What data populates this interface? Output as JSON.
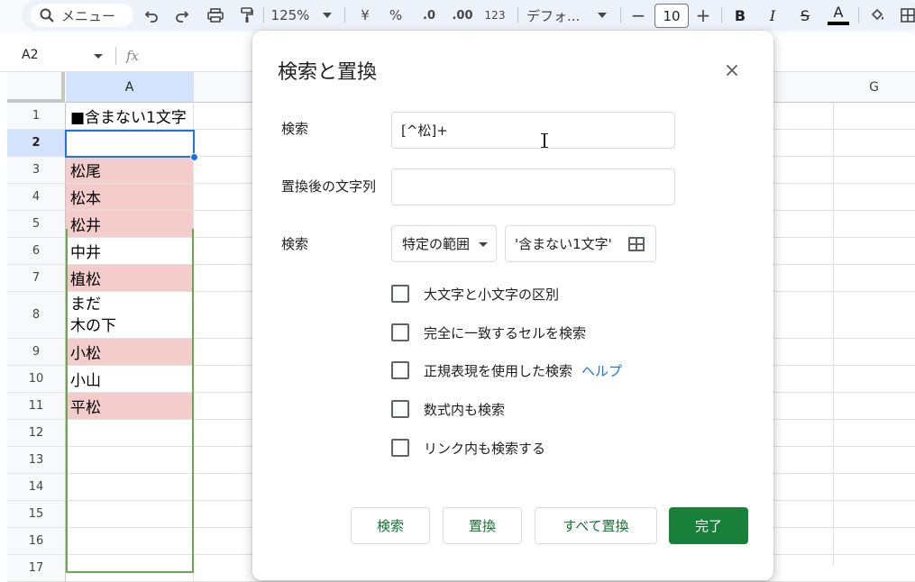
{
  "toolbar": {
    "menu_search_label": "メニュー",
    "zoom": "125%",
    "currency": "¥",
    "percent": "%",
    "decimal_decrease": ".0",
    "decimal_increase": ".00",
    "number_format": "123",
    "font": "デフォ...",
    "font_size": "10",
    "bold": "B",
    "italic": "I",
    "strike": "S",
    "text_color": "A"
  },
  "formula_bar": {
    "name_box": "A2",
    "fx": "fx"
  },
  "grid": {
    "col_headers": [
      "A",
      "G"
    ],
    "rows": [
      {
        "num": "1",
        "value": "■含まない1文字",
        "highlight": false
      },
      {
        "num": "2",
        "value": "",
        "highlight": false
      },
      {
        "num": "3",
        "value": "松尾",
        "highlight": true
      },
      {
        "num": "4",
        "value": "松本",
        "highlight": true
      },
      {
        "num": "5",
        "value": "松井",
        "highlight": true
      },
      {
        "num": "6",
        "value": "中井",
        "highlight": false
      },
      {
        "num": "7",
        "value": "植松",
        "highlight": true
      },
      {
        "num": "8",
        "value": [
          "まだ",
          "木の下"
        ],
        "highlight": false
      },
      {
        "num": "9",
        "value": "小松",
        "highlight": true
      },
      {
        "num": "10",
        "value": "小山",
        "highlight": false
      },
      {
        "num": "11",
        "value": "平松",
        "highlight": true
      },
      {
        "num": "12",
        "value": "",
        "highlight": false
      },
      {
        "num": "13",
        "value": "",
        "highlight": false
      },
      {
        "num": "14",
        "value": "",
        "highlight": false
      },
      {
        "num": "15",
        "value": "",
        "highlight": false
      },
      {
        "num": "16",
        "value": "",
        "highlight": false
      },
      {
        "num": "17",
        "value": "",
        "highlight": false
      }
    ],
    "highlight_color": "#f4cccc",
    "selection_color": "#1a73e8",
    "range_color": "#6aa84f"
  },
  "dialog": {
    "title": "検索と置換",
    "close_icon": "×",
    "find_label": "検索",
    "find_value": "[^松]+",
    "replace_label": "置換後の文字列",
    "replace_value": "",
    "scope_label": "検索",
    "scope_value": "特定の範囲",
    "range_value": "'含まない1文字'",
    "checkboxes": [
      {
        "label": "大文字と小文字の区別",
        "checked": false
      },
      {
        "label": "完全に一致するセルを検索",
        "checked": false
      },
      {
        "label": "正規表現を使用した検索",
        "checked": false
      },
      {
        "label": "数式内も検索",
        "checked": false
      },
      {
        "label": "リンク内も検索する",
        "checked": false
      }
    ],
    "help_link": "ヘルプ",
    "buttons": {
      "find": "検索",
      "replace": "置換",
      "replace_all": "すべて置換",
      "done": "完了"
    },
    "accent_color": "#188038"
  }
}
